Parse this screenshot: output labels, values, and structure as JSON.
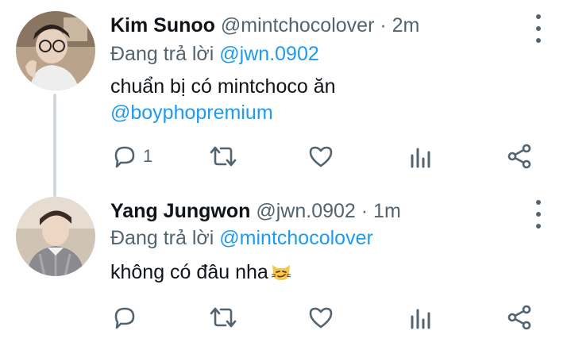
{
  "tweets": [
    {
      "name": "Kim Sunoo",
      "handle": "@mintchocolover",
      "separator": "·",
      "time": "2m",
      "reply_prefix": "Đang trả lời",
      "reply_to": "@jwn.0902",
      "text_line1": "chuẩn bị có mintchoco ăn",
      "mention": "@boyphopremium",
      "reply_count": "1",
      "avatar_icon": "avatar-photo-sunoo"
    },
    {
      "name": "Yang Jungwon",
      "handle": "@jwn.0902",
      "separator": "·",
      "time": "1m",
      "reply_prefix": "Đang trả lời",
      "reply_to": "@mintchocolover",
      "text_line1": "không có đâu nha",
      "emoji": "smirking-cat-face",
      "avatar_icon": "avatar-photo-jungwon"
    }
  ],
  "colors": {
    "link": "#1d9bf0",
    "secondary": "#536471",
    "primary": "#0f1419",
    "thread_line": "#cfd9de"
  },
  "icons": [
    "reply-icon",
    "retweet-icon",
    "like-icon",
    "analytics-icon",
    "share-icon",
    "more-icon"
  ]
}
